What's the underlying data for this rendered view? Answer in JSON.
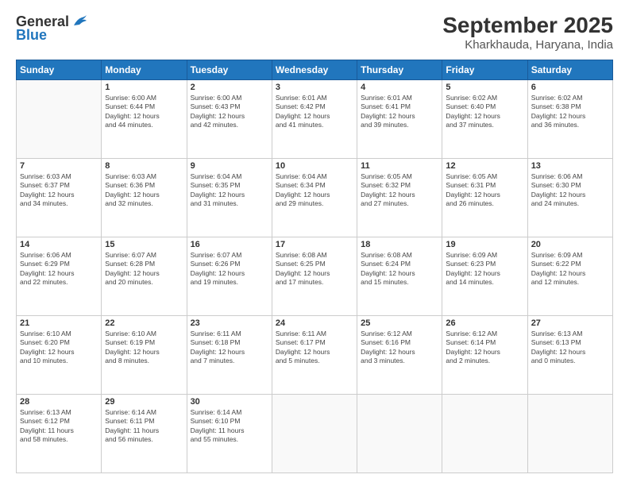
{
  "header": {
    "logo_line1": "General",
    "logo_line2": "Blue",
    "title": "September 2025",
    "subtitle": "Kharkhauda, Haryana, India"
  },
  "weekdays": [
    "Sunday",
    "Monday",
    "Tuesday",
    "Wednesday",
    "Thursday",
    "Friday",
    "Saturday"
  ],
  "weeks": [
    [
      {
        "day": "",
        "info": ""
      },
      {
        "day": "1",
        "info": "Sunrise: 6:00 AM\nSunset: 6:44 PM\nDaylight: 12 hours\nand 44 minutes."
      },
      {
        "day": "2",
        "info": "Sunrise: 6:00 AM\nSunset: 6:43 PM\nDaylight: 12 hours\nand 42 minutes."
      },
      {
        "day": "3",
        "info": "Sunrise: 6:01 AM\nSunset: 6:42 PM\nDaylight: 12 hours\nand 41 minutes."
      },
      {
        "day": "4",
        "info": "Sunrise: 6:01 AM\nSunset: 6:41 PM\nDaylight: 12 hours\nand 39 minutes."
      },
      {
        "day": "5",
        "info": "Sunrise: 6:02 AM\nSunset: 6:40 PM\nDaylight: 12 hours\nand 37 minutes."
      },
      {
        "day": "6",
        "info": "Sunrise: 6:02 AM\nSunset: 6:38 PM\nDaylight: 12 hours\nand 36 minutes."
      }
    ],
    [
      {
        "day": "7",
        "info": "Sunrise: 6:03 AM\nSunset: 6:37 PM\nDaylight: 12 hours\nand 34 minutes."
      },
      {
        "day": "8",
        "info": "Sunrise: 6:03 AM\nSunset: 6:36 PM\nDaylight: 12 hours\nand 32 minutes."
      },
      {
        "day": "9",
        "info": "Sunrise: 6:04 AM\nSunset: 6:35 PM\nDaylight: 12 hours\nand 31 minutes."
      },
      {
        "day": "10",
        "info": "Sunrise: 6:04 AM\nSunset: 6:34 PM\nDaylight: 12 hours\nand 29 minutes."
      },
      {
        "day": "11",
        "info": "Sunrise: 6:05 AM\nSunset: 6:32 PM\nDaylight: 12 hours\nand 27 minutes."
      },
      {
        "day": "12",
        "info": "Sunrise: 6:05 AM\nSunset: 6:31 PM\nDaylight: 12 hours\nand 26 minutes."
      },
      {
        "day": "13",
        "info": "Sunrise: 6:06 AM\nSunset: 6:30 PM\nDaylight: 12 hours\nand 24 minutes."
      }
    ],
    [
      {
        "day": "14",
        "info": "Sunrise: 6:06 AM\nSunset: 6:29 PM\nDaylight: 12 hours\nand 22 minutes."
      },
      {
        "day": "15",
        "info": "Sunrise: 6:07 AM\nSunset: 6:28 PM\nDaylight: 12 hours\nand 20 minutes."
      },
      {
        "day": "16",
        "info": "Sunrise: 6:07 AM\nSunset: 6:26 PM\nDaylight: 12 hours\nand 19 minutes."
      },
      {
        "day": "17",
        "info": "Sunrise: 6:08 AM\nSunset: 6:25 PM\nDaylight: 12 hours\nand 17 minutes."
      },
      {
        "day": "18",
        "info": "Sunrise: 6:08 AM\nSunset: 6:24 PM\nDaylight: 12 hours\nand 15 minutes."
      },
      {
        "day": "19",
        "info": "Sunrise: 6:09 AM\nSunset: 6:23 PM\nDaylight: 12 hours\nand 14 minutes."
      },
      {
        "day": "20",
        "info": "Sunrise: 6:09 AM\nSunset: 6:22 PM\nDaylight: 12 hours\nand 12 minutes."
      }
    ],
    [
      {
        "day": "21",
        "info": "Sunrise: 6:10 AM\nSunset: 6:20 PM\nDaylight: 12 hours\nand 10 minutes."
      },
      {
        "day": "22",
        "info": "Sunrise: 6:10 AM\nSunset: 6:19 PM\nDaylight: 12 hours\nand 8 minutes."
      },
      {
        "day": "23",
        "info": "Sunrise: 6:11 AM\nSunset: 6:18 PM\nDaylight: 12 hours\nand 7 minutes."
      },
      {
        "day": "24",
        "info": "Sunrise: 6:11 AM\nSunset: 6:17 PM\nDaylight: 12 hours\nand 5 minutes."
      },
      {
        "day": "25",
        "info": "Sunrise: 6:12 AM\nSunset: 6:16 PM\nDaylight: 12 hours\nand 3 minutes."
      },
      {
        "day": "26",
        "info": "Sunrise: 6:12 AM\nSunset: 6:14 PM\nDaylight: 12 hours\nand 2 minutes."
      },
      {
        "day": "27",
        "info": "Sunrise: 6:13 AM\nSunset: 6:13 PM\nDaylight: 12 hours\nand 0 minutes."
      }
    ],
    [
      {
        "day": "28",
        "info": "Sunrise: 6:13 AM\nSunset: 6:12 PM\nDaylight: 11 hours\nand 58 minutes."
      },
      {
        "day": "29",
        "info": "Sunrise: 6:14 AM\nSunset: 6:11 PM\nDaylight: 11 hours\nand 56 minutes."
      },
      {
        "day": "30",
        "info": "Sunrise: 6:14 AM\nSunset: 6:10 PM\nDaylight: 11 hours\nand 55 minutes."
      },
      {
        "day": "",
        "info": ""
      },
      {
        "day": "",
        "info": ""
      },
      {
        "day": "",
        "info": ""
      },
      {
        "day": "",
        "info": ""
      }
    ]
  ]
}
